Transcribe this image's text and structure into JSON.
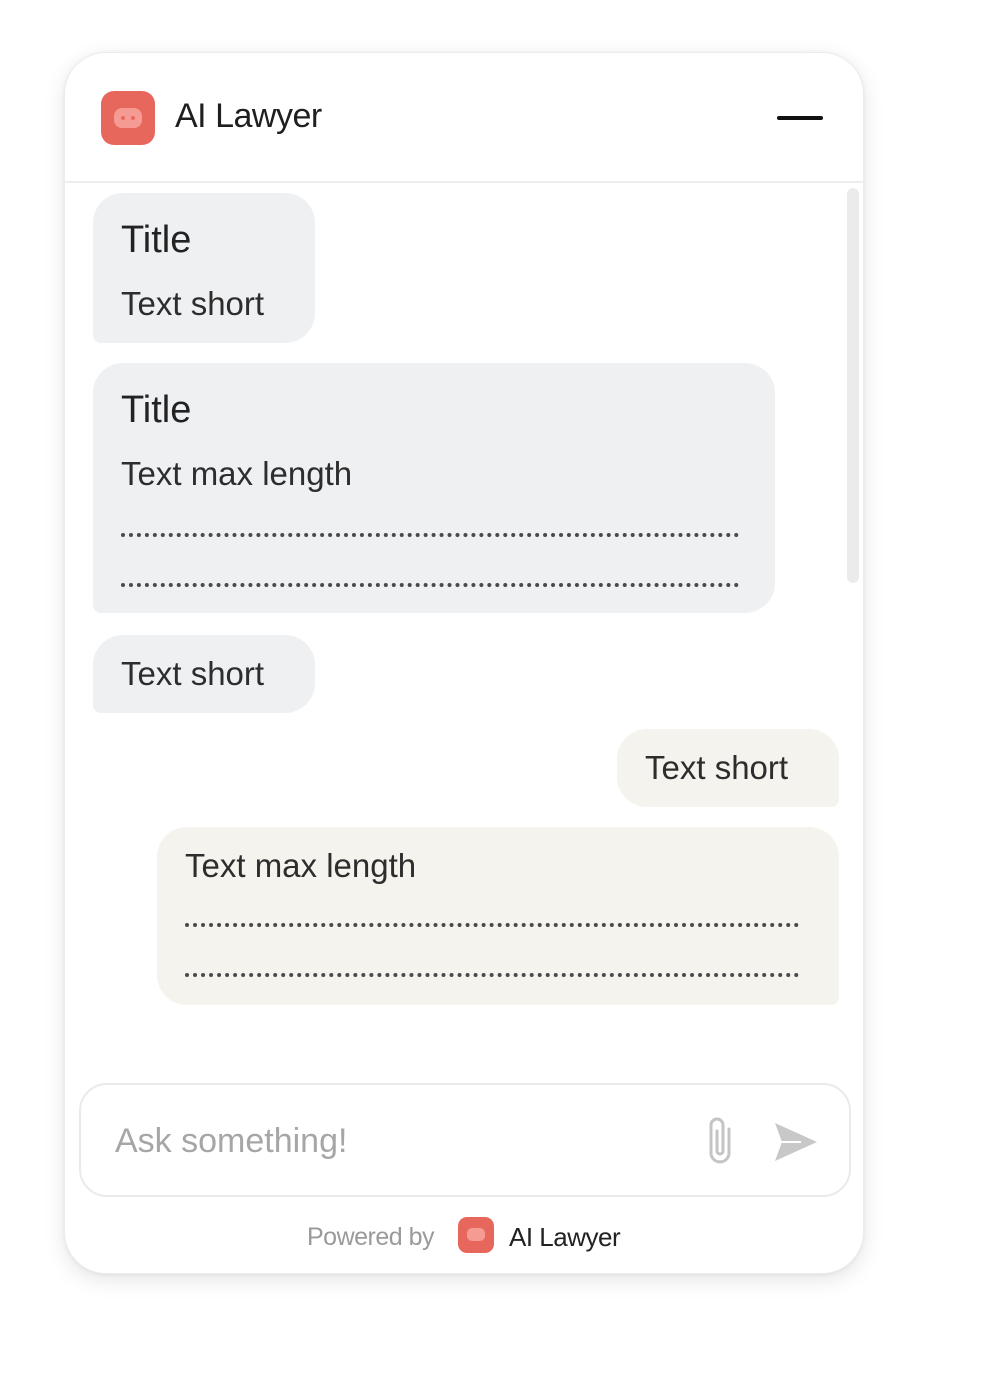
{
  "header": {
    "app_name": "AI Lawyer",
    "logo_icon": "robot-face-icon",
    "minimize_icon": "minimize-icon",
    "brand_color": "#e8675d"
  },
  "messages": [
    {
      "sender": "bot",
      "title": "Title",
      "text": "Text short"
    },
    {
      "sender": "bot",
      "title": "Title",
      "text": "Text max length"
    },
    {
      "sender": "bot",
      "text": "Text short"
    },
    {
      "sender": "user",
      "text": "Text short"
    },
    {
      "sender": "user",
      "text": "Text max length"
    }
  ],
  "composer": {
    "placeholder": "Ask something!",
    "value": "",
    "attach_icon": "paperclip-icon",
    "send_icon": "send-icon"
  },
  "footer": {
    "powered_by": "Powered by",
    "brand": "AI Lawyer",
    "logo_icon": "robot-face-icon"
  }
}
